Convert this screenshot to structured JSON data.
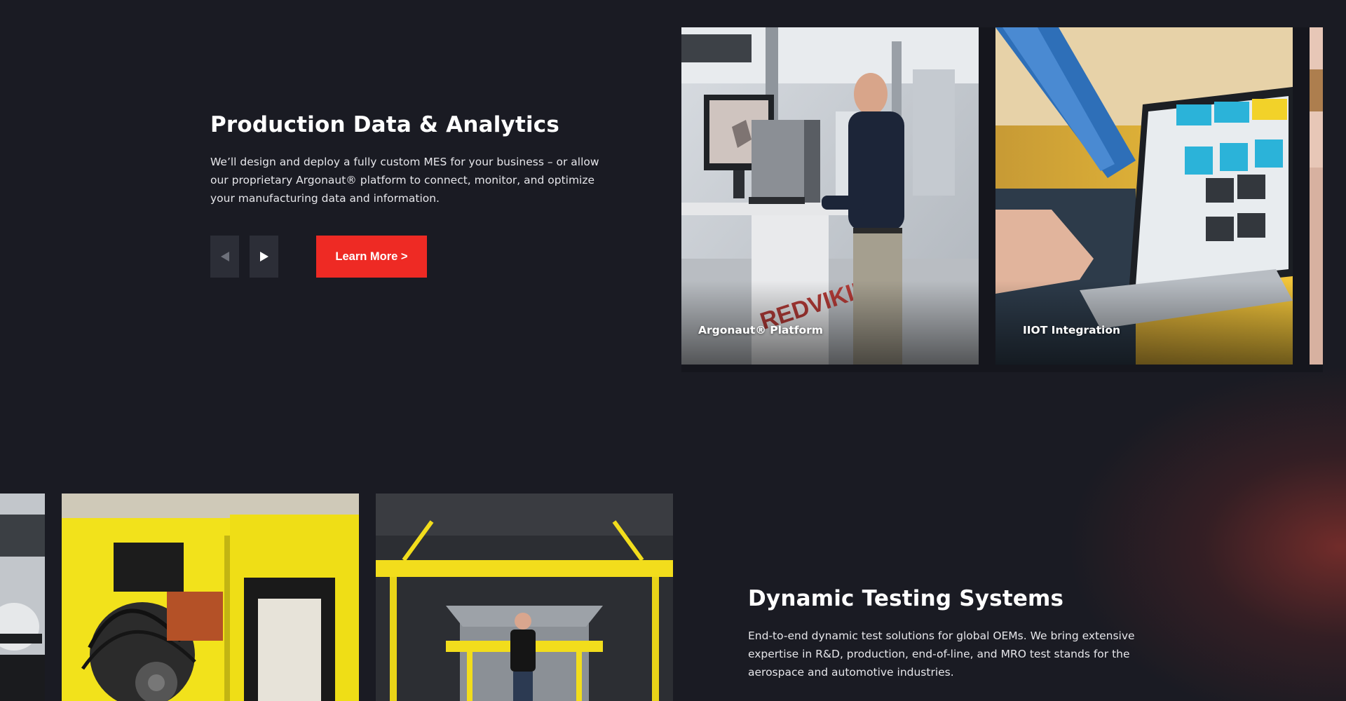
{
  "section1": {
    "title": "Production Data & Analytics",
    "description": "We’ll design and deploy a fully custom MES for your business – or allow our proprietary Argonaut® platform to connect, monitor, and optimize your manufacturing data and information.",
    "prev_icon": "triangle-left-icon",
    "next_icon": "triangle-right-icon",
    "learn_more_label": "Learn More >",
    "cards": [
      {
        "caption": "Argonaut® Platform"
      },
      {
        "caption": "IIOT Integration"
      },
      {
        "caption": ""
      }
    ]
  },
  "section2": {
    "title": "Dynamic Testing Systems",
    "description": "End-to-end dynamic test solutions for global OEMs. We bring extensive expertise in R&D, production, end-of-line, and MRO test stands for the aerospace and automotive industries."
  },
  "colors": {
    "background": "#1a1b23",
    "accent": "#ee2a24",
    "nav_button": "#2c2e37",
    "text": "#ffffff"
  }
}
